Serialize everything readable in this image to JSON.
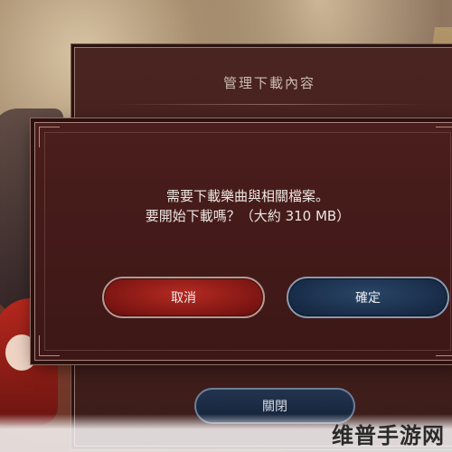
{
  "back_panel": {
    "title": "管理下載內容",
    "close_label": "關閉"
  },
  "dialog": {
    "message_line1": "需要下載樂曲與相關檔案。",
    "message_line2": "要開始下載嗎？（大約 310 MB）",
    "cancel_label": "取消",
    "confirm_label": "確定"
  },
  "watermark": {
    "text": "维普手游网"
  },
  "colors": {
    "dialog_bg": "#4a1e1c",
    "cancel_red": "#9e1f19",
    "confirm_navy": "#1e3554",
    "frame": "#a8847c"
  }
}
